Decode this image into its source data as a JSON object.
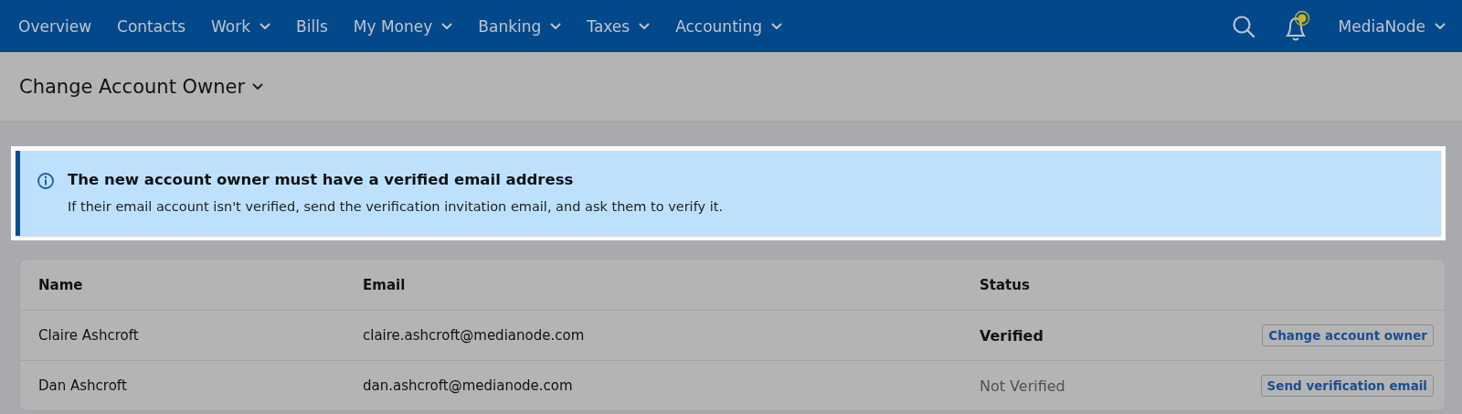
{
  "nav": {
    "items": [
      {
        "label": "Overview",
        "dropdown": false
      },
      {
        "label": "Contacts",
        "dropdown": false
      },
      {
        "label": "Work",
        "dropdown": true
      },
      {
        "label": "Bills",
        "dropdown": false
      },
      {
        "label": "My Money",
        "dropdown": true
      },
      {
        "label": "Banking",
        "dropdown": true
      },
      {
        "label": "Taxes",
        "dropdown": true
      },
      {
        "label": "Accounting",
        "dropdown": true
      }
    ],
    "account": "MediaNode"
  },
  "page_title": "Change Account Owner",
  "notice": {
    "title": "The new account owner must have a verified email address",
    "text": "If their email account isn't verified, send the verification invitation email, and ask them to verify it."
  },
  "table": {
    "columns": [
      "Name",
      "Email",
      "Status"
    ],
    "rows": [
      {
        "name": "Claire Ashcroft",
        "email": "claire.ashcroft@medianode.com",
        "status": "Verified",
        "verified": true,
        "action": "Change account owner"
      },
      {
        "name": "Dan Ashcroft",
        "email": "dan.ashcroft@medianode.com",
        "status": "Not Verified",
        "verified": false,
        "action": "Send verification email"
      }
    ]
  }
}
